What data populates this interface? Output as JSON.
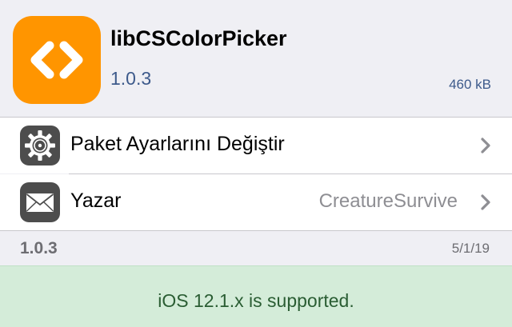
{
  "package": {
    "name": "libCSColorPicker",
    "version": "1.0.3",
    "size": "460 kB",
    "icon": "code-brackets-icon",
    "icon_color": "#ff9500"
  },
  "rows": [
    {
      "label": "Paket Ayarlarını Değiştir",
      "detail": "",
      "icon": "gear-icon"
    },
    {
      "label": "Yazar",
      "detail": "CreatureSurvive",
      "icon": "mail-icon"
    }
  ],
  "changelog": {
    "version": "1.0.3",
    "date": "5/1/19"
  },
  "support": {
    "text": "iOS 12.1.x is supported.",
    "background": "#d4ecd9",
    "text_color": "#2a5d33"
  },
  "colors": {
    "link": "#3d5a8b",
    "secondary": "#8e8e93",
    "background": "#efeff4"
  }
}
